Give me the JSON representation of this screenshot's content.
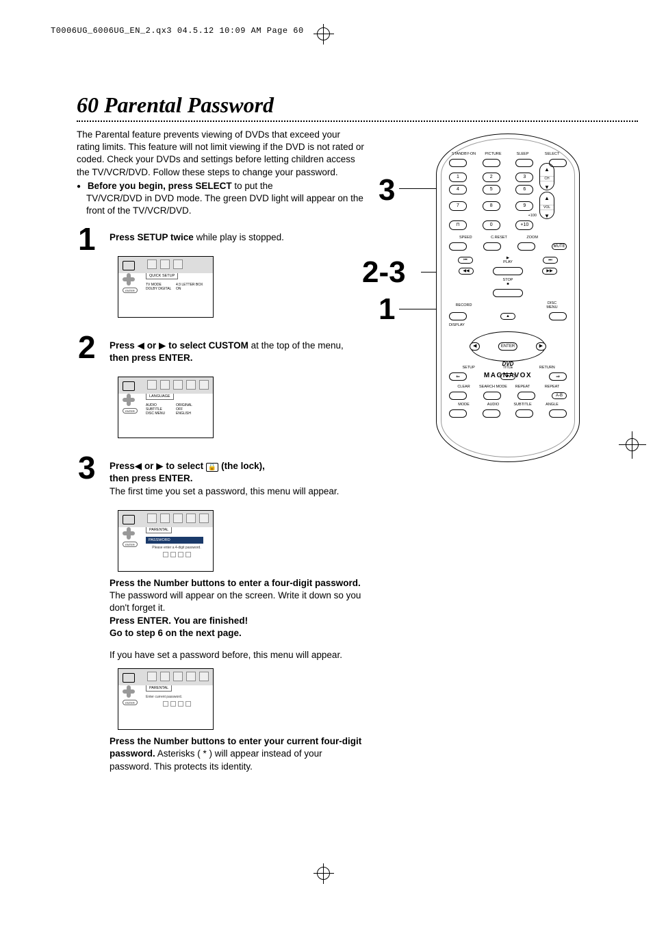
{
  "pagehead": "T0006UG_6006UG_EN_2.qx3  04.5.12  10:09 AM  Page 60",
  "title": "60  Parental Password",
  "intro": {
    "p1": "The Parental feature prevents viewing of DVDs that exceed your rating limits. This feature will not limit viewing if the DVD is not rated or coded. Check your DVDs and settings before letting children access the TV/VCR/DVD. Follow these steps to change your password.",
    "bullet_bold": "Before you begin, press SELECT",
    "bullet_rest": " to put the",
    "bullet_cont": "TV/VCR/DVD in DVD mode. The green DVD light will appear on the front of the TV/VCR/DVD."
  },
  "step1": {
    "num": "1",
    "bold": "Press SETUP twice",
    "rest": " while play is stopped."
  },
  "screenshot1": {
    "tab": "QUICK SETUP",
    "rows": [
      {
        "k": "TV MODE",
        "v": "4:3 LETTER BOX"
      },
      {
        "k": "DOLBY DIGITAL",
        "v": "ON"
      }
    ],
    "enter": "ENTER"
  },
  "step2": {
    "num": "2",
    "line1a": "Press ",
    "line1b": " or ",
    "line1c": " to select CUSTOM",
    "line1d": " at the top of the menu,",
    "line2": " then press ENTER."
  },
  "screenshot2": {
    "tab": "LANGUAGE",
    "rows": [
      {
        "k": "AUDIO",
        "v": "ORIGINAL"
      },
      {
        "k": "SUBTITLE",
        "v": "OFF"
      },
      {
        "k": "DISC MENU",
        "v": "ENGLISH"
      }
    ],
    "enter": "ENTER"
  },
  "step3": {
    "num": "3",
    "line1a": "Press",
    "line1b": " or ",
    "line1c": " to select ",
    "line1lock": " (the lock),",
    "line2": "then press ENTER.",
    "line3": "The first time you set a password, this menu will appear."
  },
  "screenshot3": {
    "tab": "PARENTAL",
    "passbar": "PASSWORD",
    "hint": "Please enter a 4-digit password.",
    "enter": "ENTER"
  },
  "after3": {
    "p1a": "Press the Number buttons to enter a four-digit password.",
    "p1b": "  The password will appear on the screen. Write it down so you don't forget it.",
    "p2": "Press ENTER.  You are finished!",
    "p3": "Go to step 6 on the next page.",
    "p4": "If you have set a password before, this menu will appear."
  },
  "screenshot4": {
    "tab": "PARENTAL",
    "hint": "Enter current password.",
    "enter": "ENTER"
  },
  "after4": {
    "p1a": "Press the Number buttons to enter your current four-digit password.",
    "p1b": "  Asterisks ( * ) will appear instead of your password. This protects its identity."
  },
  "callouts": {
    "c3a": "3",
    "c23": "2-3",
    "c1": "1"
  },
  "remote": {
    "row1": [
      "STANDBY-ON",
      "PICTURE",
      "SLEEP",
      "SELECT"
    ],
    "num123": [
      "1",
      "2",
      "3"
    ],
    "ch": "CH",
    "num456": [
      "4",
      "5",
      "6"
    ],
    "num789": [
      "7",
      "8",
      "9"
    ],
    "plus100": "+100",
    "vol": "VOL",
    "numbot": [
      "0",
      "+10"
    ],
    "row5": [
      "SPEED",
      "C.RESET",
      "ZOOM"
    ],
    "mute": "MUTE",
    "play": "PLAY",
    "stop": "STOP",
    "record": "RECORD",
    "discmenu": "DISC\nMENU",
    "display": "DISPLAY",
    "enter": "ENTER",
    "setup": "SETUP",
    "title": "TITLE",
    "return": "RETURN",
    "row_cl": [
      "CLEAR",
      "SEARCH MODE",
      "REPEAT",
      "REPEAT"
    ],
    "ab": "A-B",
    "row_bot": [
      "MODE",
      "AUDIO",
      "SUBTITLE",
      "ANGLE"
    ],
    "dvd": "DVD",
    "brand": "MAGNAVOX",
    "arrows": {
      "up": "▲",
      "down": "▼",
      "left": "◀",
      "right": "▶"
    },
    "tiny_tc": "⊓"
  }
}
